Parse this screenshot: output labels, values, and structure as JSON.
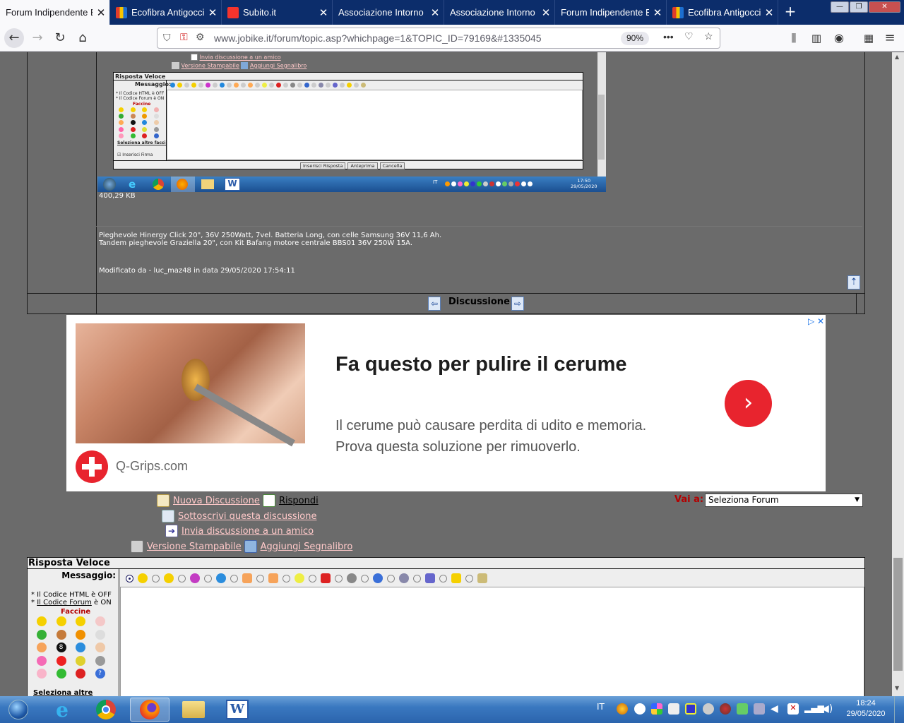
{
  "browser": {
    "tabs": [
      {
        "title": "Forum Indipendente B",
        "active": true,
        "favicon_color": "#ffffff"
      },
      {
        "title": "Ecofibra Antigocci",
        "active": false,
        "favicon_color": "#e13c2b"
      },
      {
        "title": "Subito.it",
        "active": false,
        "favicon_color": "#f5342d"
      },
      {
        "title": "Associazione Intorno",
        "active": false,
        "favicon_color": "#0c2d6b"
      },
      {
        "title": "Associazione Intorno",
        "active": false,
        "favicon_color": "#0c2d6b"
      },
      {
        "title": "Forum Indipendente B",
        "active": false,
        "favicon_color": "#0c2d6b"
      },
      {
        "title": "Ecofibra Antigocci",
        "active": false,
        "favicon_color": "#e13c2b"
      }
    ],
    "url": "www.jobike.it/forum/topic.asp?whichpage=1&TOPIC_ID=79169&#1335045",
    "zoom": "90%"
  },
  "embedded_screenshot": {
    "link_invia": "Invia discussione a un amico",
    "link_stampabile": "Versione Stampabile",
    "link_segnalibro": "Aggiungi Segnalibro",
    "form_title": "Risposta Veloce",
    "messaggio": "Messaggio:",
    "html_off": "* Il Codice HTML è OFF",
    "forum_on": "* Il Codice Forum è ON",
    "faccine": "Faccine",
    "altre": "Seleziona altre faccine",
    "firma": "Inserisci Firma",
    "btn_inserisci": "Inserisci Risposta",
    "btn_anteprima": "Anteprima",
    "btn_cancella": "Cancella",
    "clock_time": "17:50",
    "clock_date": "29/05/2020",
    "lang": "IT"
  },
  "post": {
    "filesize": "400,29 KB",
    "signature_line1": "Pieghevole Hinergy Click 20\", 36V 250Watt, 7vel. Batteria Long, con celle Samsung 36V 11,6 Ah.",
    "signature_line2": "Tandem pieghevole Graziella 20\", con Kit Bafang motore centrale BBS01 36V 250W 15A.",
    "modified": "Modificato da - luc_maz48 in data 29/05/2020 17:54:11",
    "nav_label": "Discussione"
  },
  "ad": {
    "title": "Fa questo per pulire il cerume",
    "body1": "Il cerume può causare perdita di udito e memoria.",
    "body2": "Prova questa soluzione per rimuoverlo.",
    "source": "Q-Grips.com",
    "cta": "›",
    "adchoices": "▷ ✕"
  },
  "actions": {
    "nuova": "Nuova Discussione",
    "rispondi": "Rispondi",
    "sottoscrivi": "Sottoscrivi questa discussione",
    "invia": "Invia discussione a un amico",
    "stampabile": "Versione Stampabile",
    "segnalibro": "Aggiungi Segnalibro",
    "vai_label": "Vai a:",
    "vai_value": "Seleziona Forum"
  },
  "quick_reply": {
    "title": "Risposta Veloce",
    "messaggio": "Messaggio:",
    "html_off_prefix": "* Il Codice HTML è OFF",
    "forum_link": "Il Codice Forum",
    "forum_on_suffix": " è ON",
    "faccine": "Faccine",
    "altre": "Seleziona altre faccine"
  },
  "taskbar": {
    "lang": "IT",
    "time": "18:24",
    "date": "29/05/2020"
  }
}
